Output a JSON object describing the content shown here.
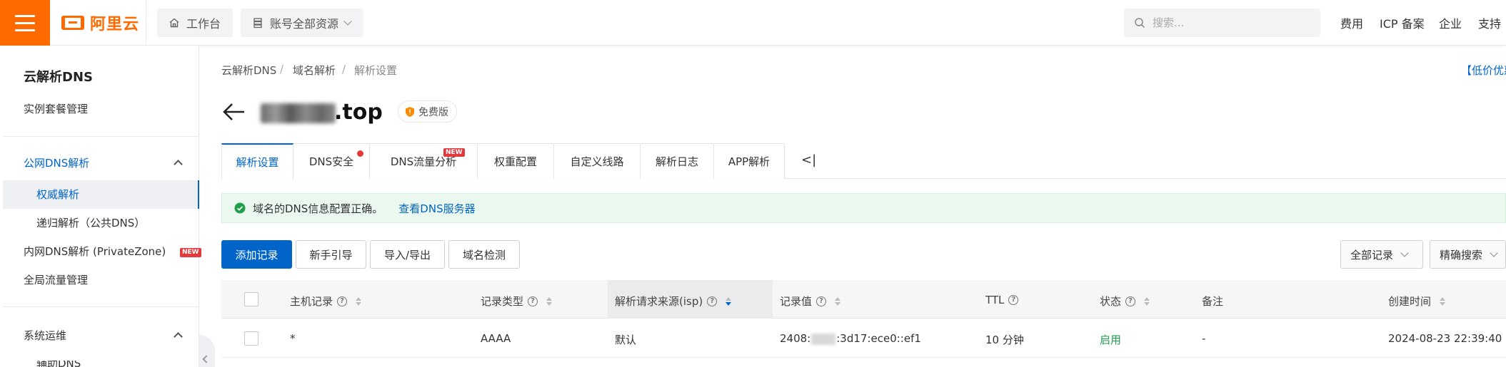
{
  "topbar": {
    "brand": "阿里云",
    "workbench": "工作台",
    "resources": "账号全部资源",
    "search_placeholder": "搜索...",
    "links": [
      "费用",
      "ICP 备案",
      "企业",
      "支持"
    ]
  },
  "sidebar": {
    "title": "云解析DNS",
    "instance_mgmt": "实例套餐管理",
    "public_group": "公网DNS解析",
    "authoritative": "权威解析",
    "recursive": "递归解析（公共DNS）",
    "private_zone": "内网DNS解析 (PrivateZone)",
    "new_badge": "NEW",
    "global_traffic": "全局流量管理",
    "ops_group": "系统运维",
    "auxiliary": "辅助DNS"
  },
  "breadcrumb": [
    "云解析DNS",
    "域名解析",
    "解析设置"
  ],
  "promo": "【低价优惠】",
  "domain": {
    "tld": ".top",
    "edition": "免费版"
  },
  "tabs": {
    "items": [
      "解析设置",
      "DNS安全",
      "DNS流量分析",
      "权重配置",
      "自定义线路",
      "解析日志",
      "APP解析"
    ],
    "new_badge": "NEW",
    "more": "<|"
  },
  "alert": {
    "text": "域名的DNS信息配置正确。",
    "link": "查看DNS服务器"
  },
  "toolbar": {
    "add": "添加记录",
    "guide": "新手引导",
    "import_export": "导入/导出",
    "check": "域名检测",
    "filter": "全部记录",
    "precise": "精确搜索"
  },
  "table": {
    "headers": [
      "主机记录",
      "记录类型",
      "解析请求来源(isp)",
      "记录值",
      "TTL",
      "状态",
      "备注",
      "创建时间"
    ],
    "rows": [
      {
        "host": "*",
        "type": "AAAA",
        "isp": "默认",
        "value_prefix": "2408:",
        "value_suffix": ":3d17:ece0::ef1",
        "ttl": "10 分钟",
        "status": "启用",
        "remark": "-",
        "created": "2024-08-23 22:39:40"
      }
    ]
  },
  "colors": {
    "brand": "#ff6a00",
    "primary": "#0064c8",
    "success": "#1e9e4a",
    "alert_bg": "#ebf8f0"
  }
}
